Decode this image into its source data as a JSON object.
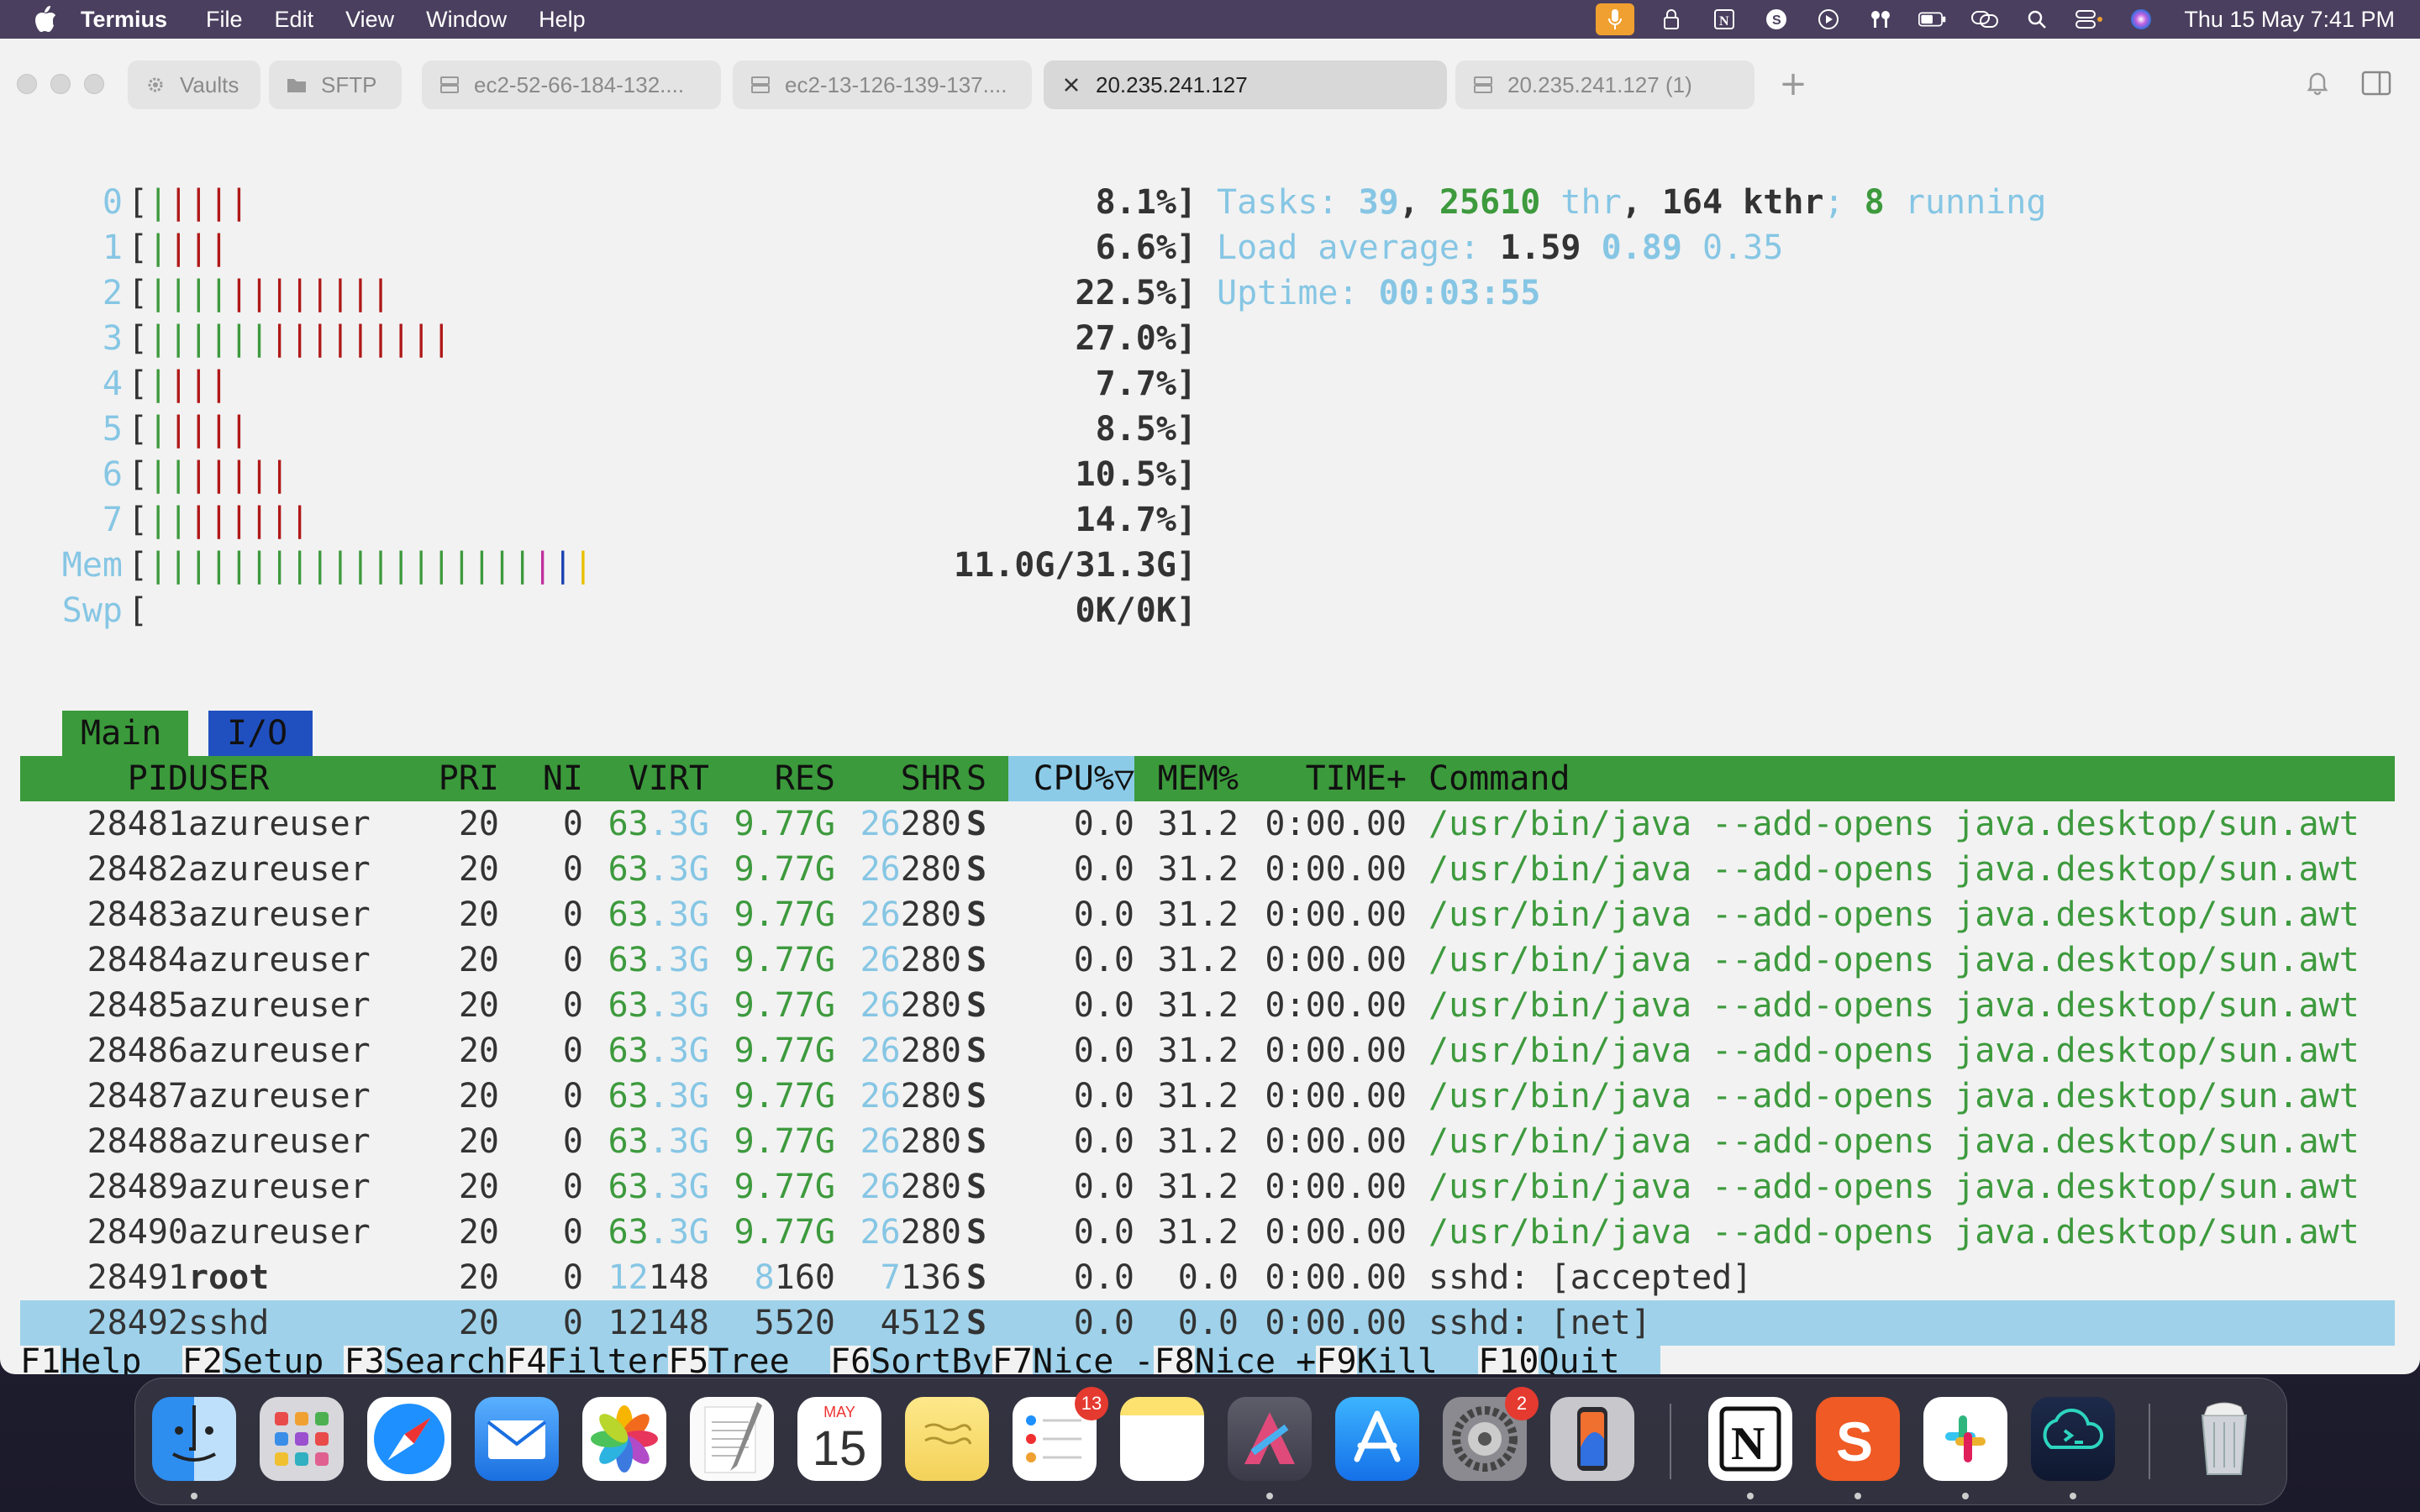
{
  "menubar": {
    "app_name": "Termius",
    "items": [
      "File",
      "Edit",
      "View",
      "Window",
      "Help"
    ],
    "clock": "Thu 15 May  7:41 PM"
  },
  "tabs": {
    "vaults": "Vaults",
    "sftp": "SFTP",
    "host1": "ec2-52-66-184-132....",
    "host2": "ec2-13-126-139-137....",
    "active": "20.235.241.127",
    "host4": "20.235.241.127 (1)"
  },
  "cpus": [
    {
      "id": "0",
      "pct": "8.1%]",
      "green": 1,
      "red": 4
    },
    {
      "id": "1",
      "pct": "6.6%]",
      "green": 1,
      "red": 3
    },
    {
      "id": "2",
      "pct": "22.5%]",
      "green": 4,
      "red": 8
    },
    {
      "id": "3",
      "pct": "27.0%]",
      "green": 6,
      "red": 9
    },
    {
      "id": "4",
      "pct": "7.7%]",
      "green": 1,
      "red": 3
    },
    {
      "id": "5",
      "pct": "8.5%]",
      "green": 1,
      "red": 4
    },
    {
      "id": "6",
      "pct": "10.5%]",
      "green": 2,
      "red": 5
    },
    {
      "id": "7",
      "pct": "14.7%]",
      "green": 2,
      "red": 6
    }
  ],
  "mem": {
    "label": "Mem",
    "value": "11.0G/31.3G]"
  },
  "swp": {
    "label": "Swp",
    "value": "0K/0K]"
  },
  "summary": {
    "tasks_label": "Tasks: ",
    "tasks": "39",
    "thr": "25610",
    "thr_label": " thr",
    "kthr": "164 kthr",
    "running": "8",
    "running_label": " running",
    "load_label": "Load average: ",
    "load1": "1.59",
    "load5": "0.89",
    "load15": "0.35",
    "uptime_label": "Uptime: ",
    "uptime": "00:03:55"
  },
  "screen_tabs": {
    "main": "Main",
    "io": "I/O"
  },
  "columns": {
    "pid": "PID",
    "user": "USER",
    "pri": "PRI",
    "ni": "NI",
    "virt": "VIRT",
    "res": "RES",
    "shr": "SHR",
    "s": "S",
    "cpu": "CPU%▽",
    "mem": "MEM%",
    "time": "TIME+",
    "command": "Command"
  },
  "processes": [
    {
      "pid": "28481",
      "user": "azureuser",
      "pri": "20",
      "ni": "0",
      "virt_a": "63",
      "virt_b": ".3G",
      "res_a": "9",
      "res_b": ".77G",
      "shr_a": "26",
      "shr_b": "280",
      "s": "S",
      "cpu": "0.0",
      "mem": "31.2",
      "time": "0:00.00",
      "cmd": "/usr/bin/java --add-opens java.desktop/sun.awt"
    },
    {
      "pid": "28482",
      "user": "azureuser",
      "pri": "20",
      "ni": "0",
      "virt_a": "63",
      "virt_b": ".3G",
      "res_a": "9",
      "res_b": ".77G",
      "shr_a": "26",
      "shr_b": "280",
      "s": "S",
      "cpu": "0.0",
      "mem": "31.2",
      "time": "0:00.00",
      "cmd": "/usr/bin/java --add-opens java.desktop/sun.awt"
    },
    {
      "pid": "28483",
      "user": "azureuser",
      "pri": "20",
      "ni": "0",
      "virt_a": "63",
      "virt_b": ".3G",
      "res_a": "9",
      "res_b": ".77G",
      "shr_a": "26",
      "shr_b": "280",
      "s": "S",
      "cpu": "0.0",
      "mem": "31.2",
      "time": "0:00.00",
      "cmd": "/usr/bin/java --add-opens java.desktop/sun.awt"
    },
    {
      "pid": "28484",
      "user": "azureuser",
      "pri": "20",
      "ni": "0",
      "virt_a": "63",
      "virt_b": ".3G",
      "res_a": "9",
      "res_b": ".77G",
      "shr_a": "26",
      "shr_b": "280",
      "s": "S",
      "cpu": "0.0",
      "mem": "31.2",
      "time": "0:00.00",
      "cmd": "/usr/bin/java --add-opens java.desktop/sun.awt"
    },
    {
      "pid": "28485",
      "user": "azureuser",
      "pri": "20",
      "ni": "0",
      "virt_a": "63",
      "virt_b": ".3G",
      "res_a": "9",
      "res_b": ".77G",
      "shr_a": "26",
      "shr_b": "280",
      "s": "S",
      "cpu": "0.0",
      "mem": "31.2",
      "time": "0:00.00",
      "cmd": "/usr/bin/java --add-opens java.desktop/sun.awt"
    },
    {
      "pid": "28486",
      "user": "azureuser",
      "pri": "20",
      "ni": "0",
      "virt_a": "63",
      "virt_b": ".3G",
      "res_a": "9",
      "res_b": ".77G",
      "shr_a": "26",
      "shr_b": "280",
      "s": "S",
      "cpu": "0.0",
      "mem": "31.2",
      "time": "0:00.00",
      "cmd": "/usr/bin/java --add-opens java.desktop/sun.awt"
    },
    {
      "pid": "28487",
      "user": "azureuser",
      "pri": "20",
      "ni": "0",
      "virt_a": "63",
      "virt_b": ".3G",
      "res_a": "9",
      "res_b": ".77G",
      "shr_a": "26",
      "shr_b": "280",
      "s": "S",
      "cpu": "0.0",
      "mem": "31.2",
      "time": "0:00.00",
      "cmd": "/usr/bin/java --add-opens java.desktop/sun.awt"
    },
    {
      "pid": "28488",
      "user": "azureuser",
      "pri": "20",
      "ni": "0",
      "virt_a": "63",
      "virt_b": ".3G",
      "res_a": "9",
      "res_b": ".77G",
      "shr_a": "26",
      "shr_b": "280",
      "s": "S",
      "cpu": "0.0",
      "mem": "31.2",
      "time": "0:00.00",
      "cmd": "/usr/bin/java --add-opens java.desktop/sun.awt"
    },
    {
      "pid": "28489",
      "user": "azureuser",
      "pri": "20",
      "ni": "0",
      "virt_a": "63",
      "virt_b": ".3G",
      "res_a": "9",
      "res_b": ".77G",
      "shr_a": "26",
      "shr_b": "280",
      "s": "S",
      "cpu": "0.0",
      "mem": "31.2",
      "time": "0:00.00",
      "cmd": "/usr/bin/java --add-opens java.desktop/sun.awt"
    },
    {
      "pid": "28490",
      "user": "azureuser",
      "pri": "20",
      "ni": "0",
      "virt_a": "63",
      "virt_b": ".3G",
      "res_a": "9",
      "res_b": ".77G",
      "shr_a": "26",
      "shr_b": "280",
      "s": "S",
      "cpu": "0.0",
      "mem": "31.2",
      "time": "0:00.00",
      "cmd": "/usr/bin/java --add-opens java.desktop/sun.awt"
    },
    {
      "pid": "28491",
      "user": "root",
      "pri": "20",
      "ni": "0",
      "virt_a": "12",
      "virt_b": "148",
      "res_a": "8",
      "res_b": "160",
      "shr_a": "7",
      "shr_b": "136",
      "s": "S",
      "cpu": "0.0",
      "mem": "0.0",
      "time": "0:00.00",
      "cmd": "sshd: [accepted]"
    },
    {
      "pid": "28492",
      "user": "sshd",
      "pri": "20",
      "ni": "0",
      "virt_a": "12148",
      "virt_b": "",
      "res_a": "5520",
      "res_b": "",
      "shr_a": "4512",
      "shr_b": "",
      "s": "S",
      "cpu": "0.0",
      "mem": "0.0",
      "time": "0:00.00",
      "cmd": "sshd: [net]"
    }
  ],
  "fkeys": [
    {
      "k": "F1",
      "l": "Help  "
    },
    {
      "k": "F2",
      "l": "Setup "
    },
    {
      "k": "F3",
      "l": "Search"
    },
    {
      "k": "F4",
      "l": "Filter"
    },
    {
      "k": "F5",
      "l": "Tree  "
    },
    {
      "k": "F6",
      "l": "SortBy"
    },
    {
      "k": "F7",
      "l": "Nice -"
    },
    {
      "k": "F8",
      "l": "Nice +"
    },
    {
      "k": "F9",
      "l": "Kill  "
    },
    {
      "k": "F10",
      "l": "Quit  "
    }
  ],
  "dock": {
    "calendar_month": "MAY",
    "calendar_day": "15",
    "reminders_badge": "13",
    "settings_badge": "2"
  }
}
